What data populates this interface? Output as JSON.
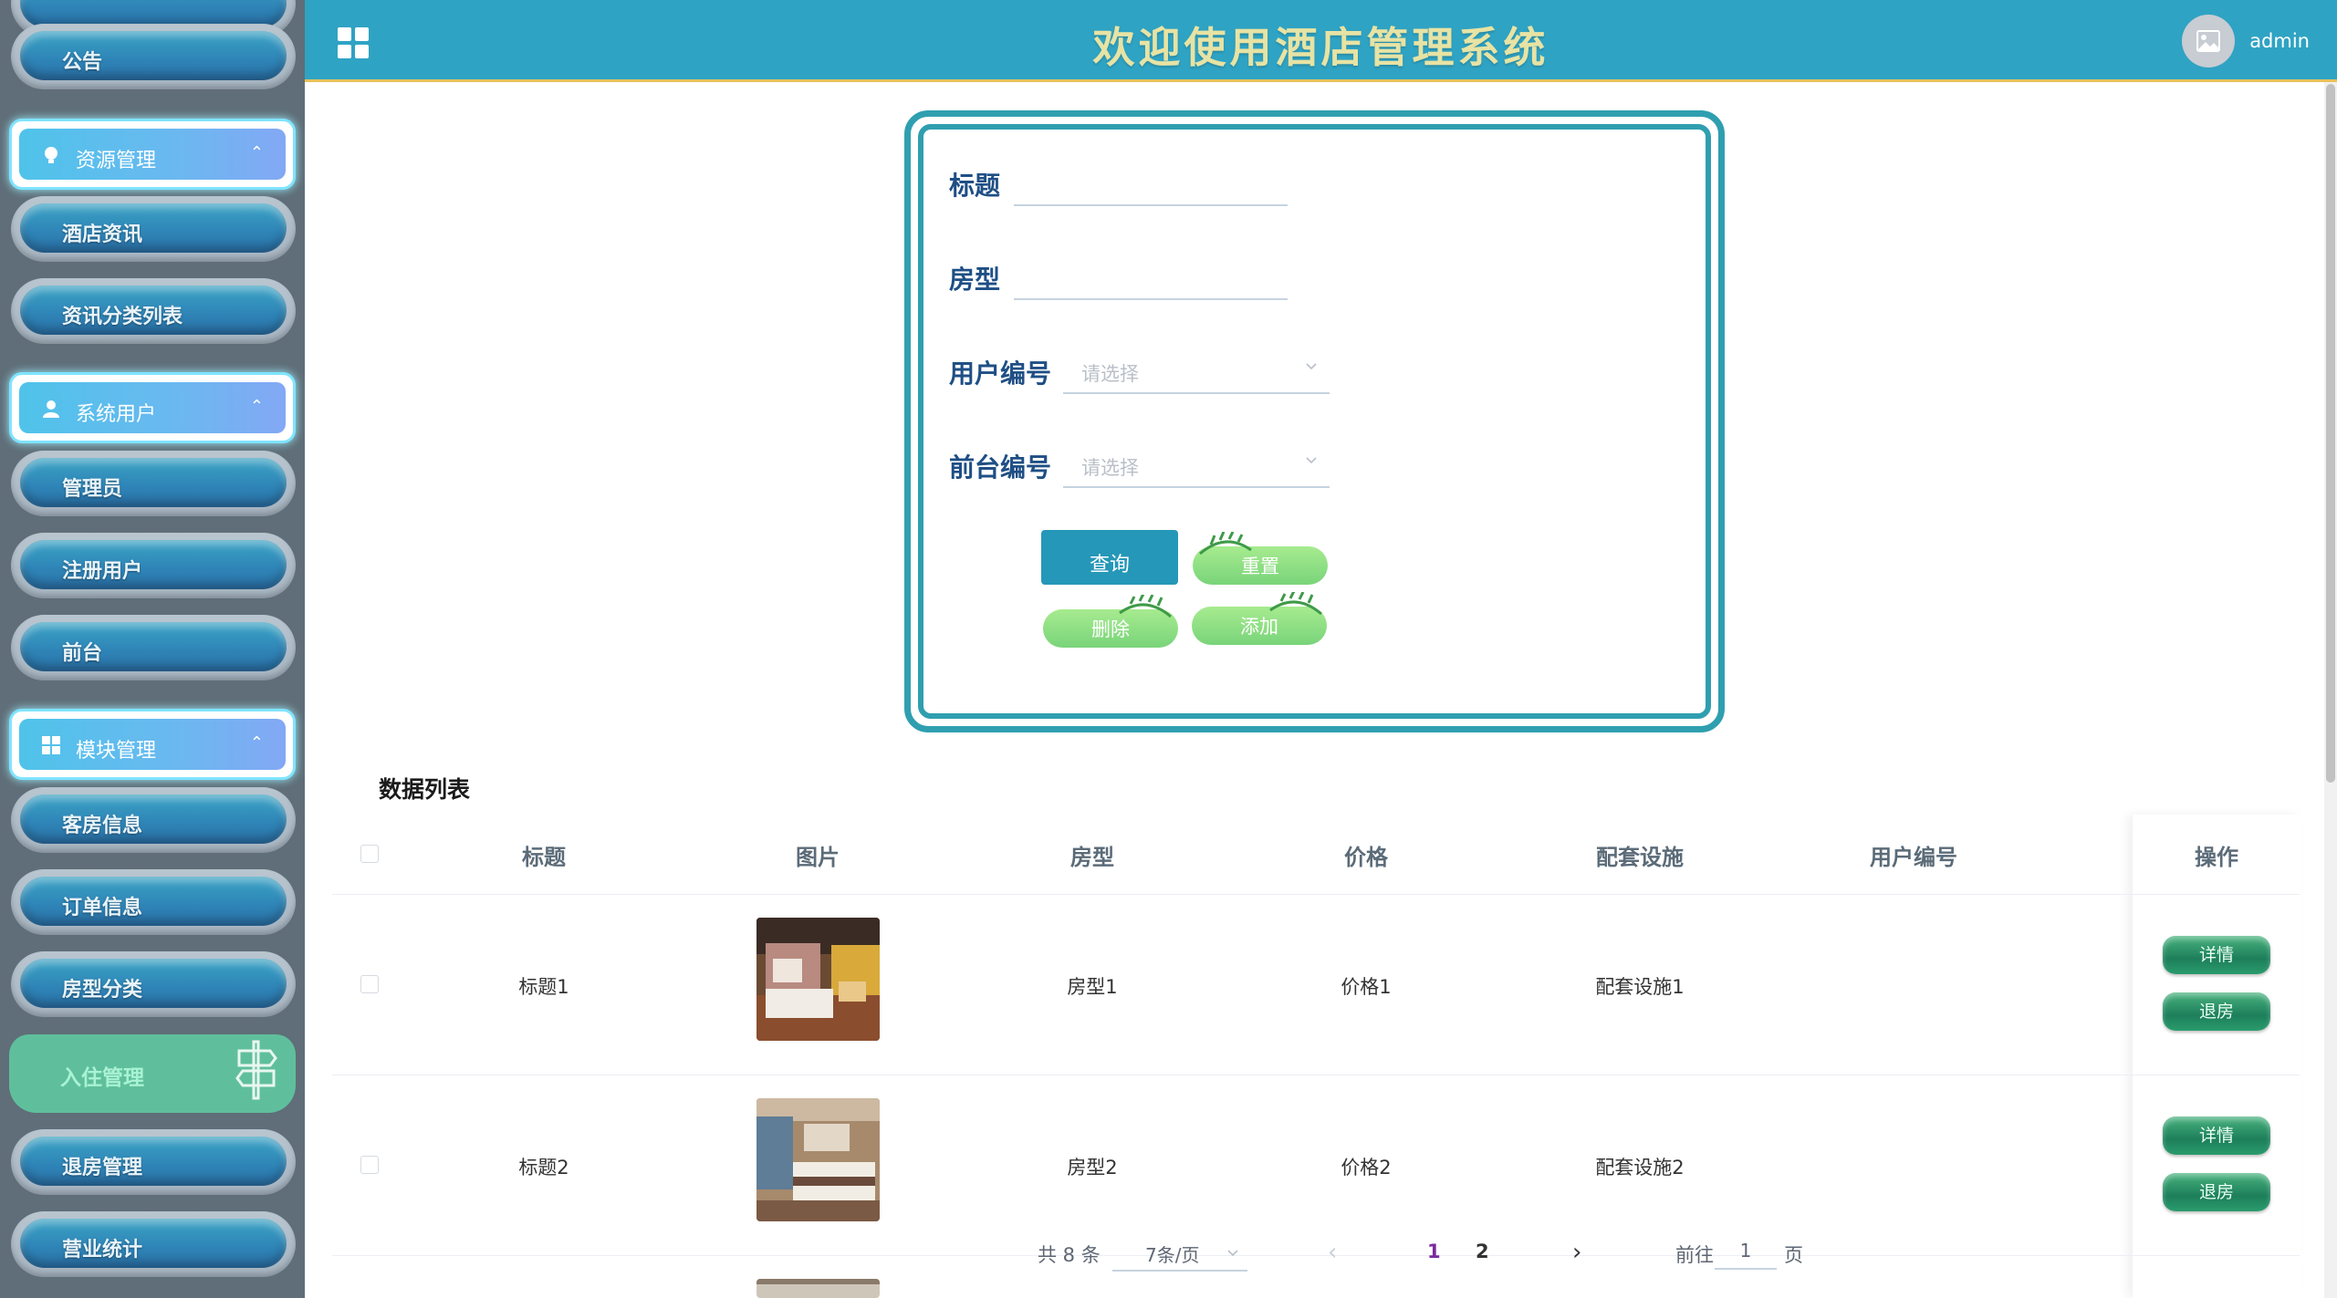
{
  "header": {
    "title": "欢迎使用酒店管理系统",
    "username": "admin"
  },
  "sidebar": {
    "items": [
      {
        "label": "公告"
      },
      {
        "label": "酒店资讯"
      },
      {
        "label": "资讯分类列表"
      },
      {
        "label": "管理员"
      },
      {
        "label": "注册用户"
      },
      {
        "label": "前台"
      },
      {
        "label": "客房信息"
      },
      {
        "label": "订单信息"
      },
      {
        "label": "房型分类"
      },
      {
        "label": "入住管理"
      },
      {
        "label": "退房管理"
      },
      {
        "label": "营业统计"
      }
    ],
    "groups": [
      {
        "label": "资源管理"
      },
      {
        "label": "系统用户"
      },
      {
        "label": "模块管理"
      }
    ]
  },
  "search": {
    "title_label": "标题",
    "title_value": "",
    "room_type_label": "房型",
    "room_type_value": "",
    "user_no_label": "用户编号",
    "user_no_placeholder": "请选择",
    "desk_no_label": "前台编号",
    "desk_no_placeholder": "请选择",
    "query_label": "查询",
    "reset_label": "重置",
    "delete_label": "删除",
    "add_label": "添加"
  },
  "table": {
    "section_title": "数据列表",
    "columns": [
      "标题",
      "图片",
      "房型",
      "价格",
      "配套设施",
      "用户编号",
      "操作"
    ],
    "rows": [
      {
        "title": "标题1",
        "room_type": "房型1",
        "price": "价格1",
        "facilities": "配套设施1",
        "user_no": "",
        "detail": "详情",
        "checkout": "退房"
      },
      {
        "title": "标题2",
        "room_type": "房型2",
        "price": "价格2",
        "facilities": "配套设施2",
        "user_no": "",
        "detail": "详情",
        "checkout": "退房"
      }
    ]
  },
  "pagination": {
    "total": "共 8 条",
    "page_size": "7条/页",
    "pages": [
      "1",
      "2"
    ],
    "current_page": "1",
    "goto_label": "前往",
    "goto_value": "1",
    "page_unit": "页"
  },
  "colors": {
    "header_bg": "#2fa3c3",
    "accent": "#2f9fb0",
    "label_blue": "#1f4f85",
    "active_menu": "#5fbf9c"
  }
}
